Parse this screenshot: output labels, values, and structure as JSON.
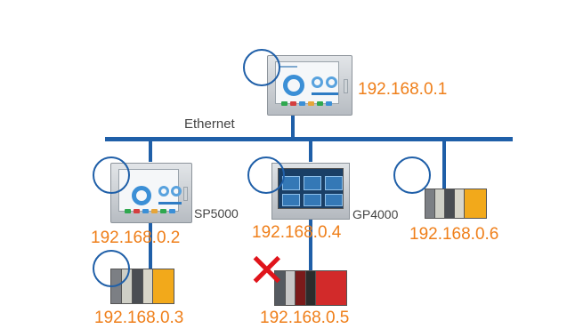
{
  "network": {
    "label": "Ethernet",
    "color": "#1f5fa8"
  },
  "ip_color": "#ef7f1a",
  "devices": {
    "hmi_top": {
      "ip": "192.168.0.1"
    },
    "sp5000": {
      "model": "SP5000",
      "ip": "192.168.0.2"
    },
    "plc_left": {
      "ip": "192.168.0.3"
    },
    "gp4000": {
      "model": "GP4000",
      "ip": "192.168.0.4"
    },
    "plc_red": {
      "ip": "192.168.0.5",
      "status": "disconnected"
    },
    "plc_right": {
      "ip": "192.168.0.6"
    }
  },
  "status_mark": "✕"
}
